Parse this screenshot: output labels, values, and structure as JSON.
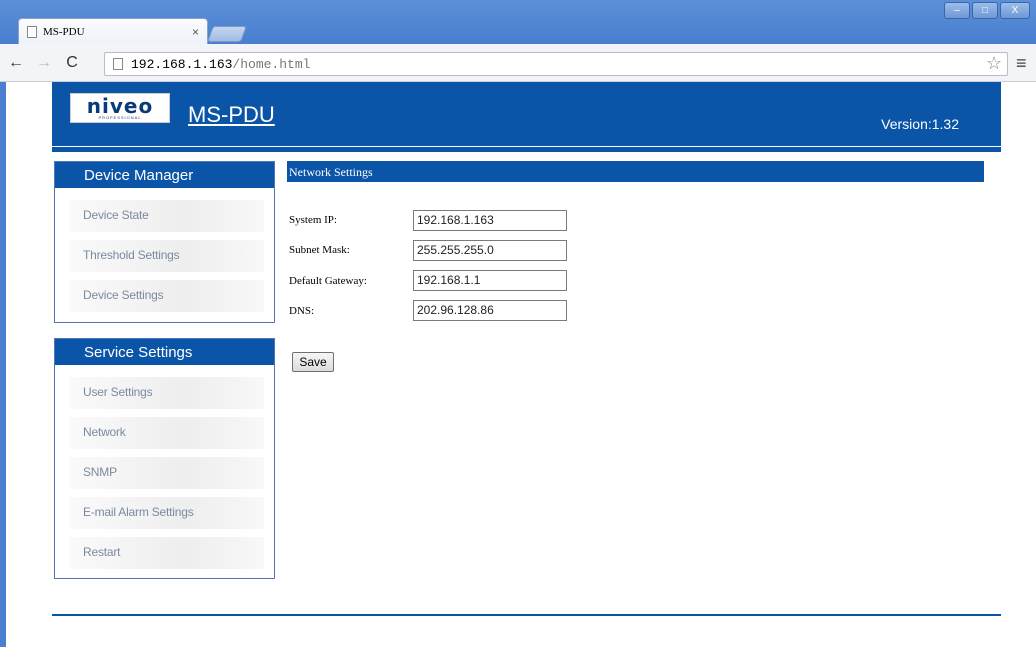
{
  "browser": {
    "tab_title": "MS-PDU",
    "tab_close": "×",
    "url_host": "192.168.1.163",
    "url_path": "/home.html",
    "window_controls": [
      "–",
      "□",
      "X"
    ]
  },
  "header": {
    "logo_text": "niveo",
    "logo_sub": "PROFESSIONAL",
    "product_title": "MS-PDU",
    "version": "Version:1.32"
  },
  "sidebar": {
    "device_manager": {
      "title": "Device Manager",
      "items": [
        "Device State",
        "Threshold Settings",
        "Device Settings"
      ]
    },
    "service_settings": {
      "title": "Service Settings",
      "items": [
        "User Settings",
        "Network",
        "SNMP",
        "E-mail Alarm Settings",
        "Restart"
      ]
    }
  },
  "network_settings": {
    "title": "Network Settings",
    "fields": {
      "system_ip": {
        "label": "System IP:",
        "value": "192.168.1.163"
      },
      "subnet_mask": {
        "label": "Subnet Mask:",
        "value": "255.255.255.0"
      },
      "default_gateway": {
        "label": "Default Gateway:",
        "value": "192.168.1.1"
      },
      "dns": {
        "label": "DNS:",
        "value": "202.96.128.86"
      }
    },
    "save_label": "Save"
  },
  "colors": {
    "brand_blue": "#0b55a8",
    "chrome_blue": "#4a7fcf"
  }
}
